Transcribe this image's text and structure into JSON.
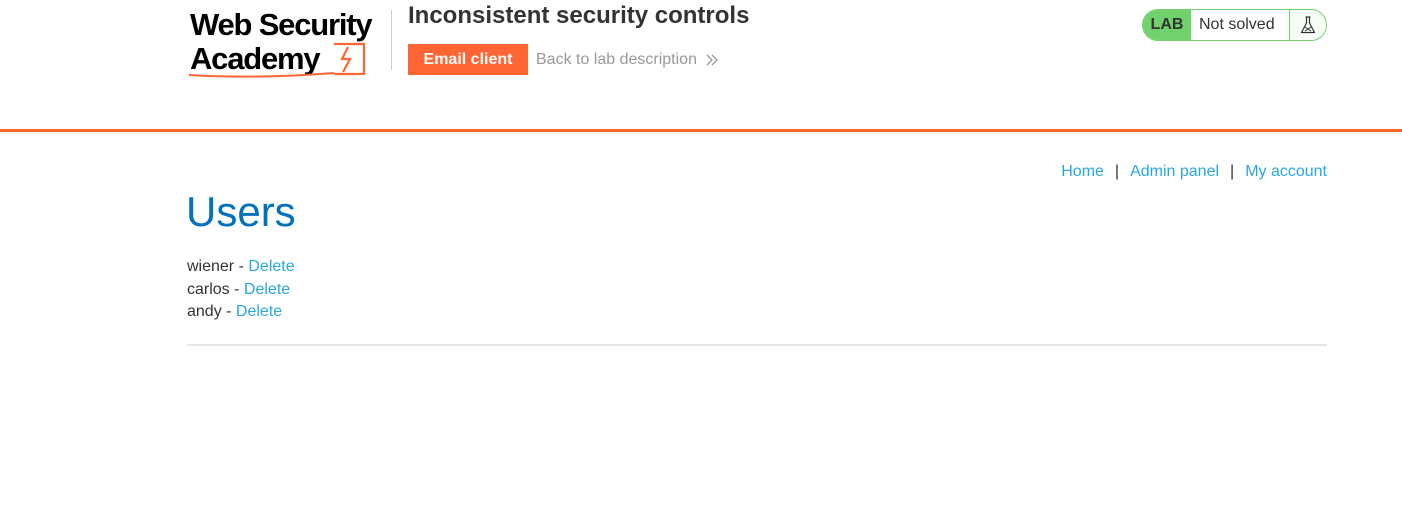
{
  "logo": {
    "line1": "Web Security",
    "line2": "Academy"
  },
  "lab": {
    "title": "Inconsistent security controls",
    "email_client_label": "Email client",
    "back_link_label": "Back to lab description",
    "badge_label": "LAB",
    "status": "Not solved"
  },
  "nav": {
    "home": "Home",
    "separator": "|",
    "admin_panel": "Admin panel",
    "my_account": "My account"
  },
  "page": {
    "heading": "Users"
  },
  "users": [
    {
      "name": "wiener",
      "sep": " - ",
      "action": "Delete"
    },
    {
      "name": "carlos",
      "sep": " - ",
      "action": "Delete"
    },
    {
      "name": "andy",
      "sep": " - ",
      "action": "Delete"
    }
  ],
  "colors": {
    "accent_orange": "#ff6633",
    "link_blue": "#29a8db",
    "heading_blue": "#0071bc",
    "lab_green": "#70d16d"
  },
  "icons": {
    "logo_mark": "lightning-bolt-icon",
    "back_chevron": "double-chevron-right-icon",
    "lab_flask": "flask-icon"
  }
}
